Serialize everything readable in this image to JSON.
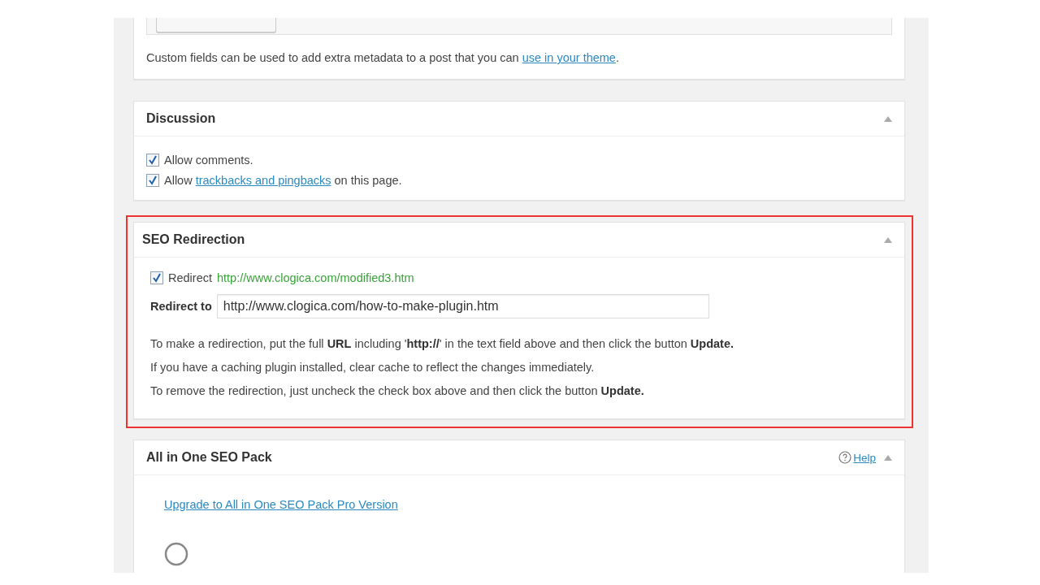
{
  "custom_fields": {
    "note_before": "Custom fields can be used to add extra metadata to a post that you can ",
    "note_link": "use in your theme",
    "note_after": "."
  },
  "discussion": {
    "title": "Discussion",
    "items": [
      {
        "checked": true,
        "text_before": "Allow comments."
      },
      {
        "checked": true,
        "text_before": "Allow ",
        "link": "trackbacks and pingbacks",
        "text_after": " on this page."
      }
    ]
  },
  "seo_redirection": {
    "title": "SEO Redirection",
    "highlighted": true,
    "redirect": {
      "checked": true,
      "label": "Redirect",
      "url": "http://www.clogica.com/modified3.htm"
    },
    "field": {
      "label": "Redirect to",
      "value": "http://www.clogica.com/how-to-make-plugin.htm"
    },
    "instructions": [
      "To make a redirection, put the full **URL** including '**http://**' in the text field above and then click the button **Update.**",
      "If you have a caching plugin installed, clear cache to reflect the changes immediately.",
      "To remove the redirection, just uncheck the check box above and then click the button **Update.**"
    ]
  },
  "aioseo": {
    "title": "All in One SEO Pack",
    "help": "Help",
    "upgrade_link": "Upgrade to All in One SEO Pack Pro Version"
  }
}
